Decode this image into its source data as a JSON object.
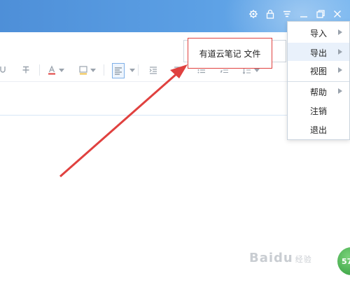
{
  "callout": {
    "text": "有道云笔记 文件"
  },
  "menu": {
    "items": [
      {
        "label": "导入",
        "has_submenu": true
      },
      {
        "label": "导出",
        "has_submenu": true
      },
      {
        "label": "视图",
        "has_submenu": true
      },
      {
        "label": "帮助",
        "has_submenu": true
      },
      {
        "label": "注销",
        "has_submenu": false
      },
      {
        "label": "退出",
        "has_submenu": false
      }
    ],
    "highlighted": "导出"
  },
  "window_controls": [
    "settings-icon",
    "lock-icon",
    "menu-icon",
    "minimize-icon",
    "restore-icon",
    "close-icon"
  ],
  "watermark": {
    "brand": "Baidu",
    "suffix": "经验"
  },
  "badge": {
    "text": "57"
  },
  "colors": {
    "titlebar": "#5b9fe4",
    "annotation": "#e0413f",
    "menu_hover": "#e9f1fb"
  }
}
